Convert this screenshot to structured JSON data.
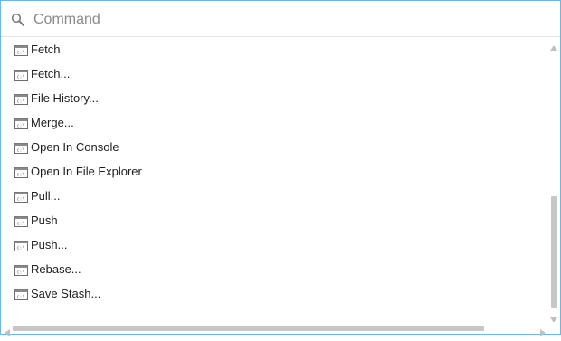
{
  "search": {
    "placeholder": "Command",
    "value": "",
    "icon": "search-icon"
  },
  "commands": [
    {
      "label": "Fetch",
      "icon": "console-window-icon"
    },
    {
      "label": "Fetch...",
      "icon": "console-window-icon"
    },
    {
      "label": "File History...",
      "icon": "console-window-icon"
    },
    {
      "label": "Merge...",
      "icon": "console-window-icon"
    },
    {
      "label": "Open In Console",
      "icon": "console-window-icon"
    },
    {
      "label": "Open In File Explorer",
      "icon": "console-window-icon"
    },
    {
      "label": "Pull...",
      "icon": "console-window-icon"
    },
    {
      "label": "Push",
      "icon": "console-window-icon"
    },
    {
      "label": "Push...",
      "icon": "console-window-icon"
    },
    {
      "label": "Rebase...",
      "icon": "console-window-icon"
    },
    {
      "label": "Save Stash...",
      "icon": "console-window-icon"
    }
  ],
  "colors": {
    "border_accent": "#6fb6e4",
    "scroll_thumb": "#c6c6c6"
  }
}
